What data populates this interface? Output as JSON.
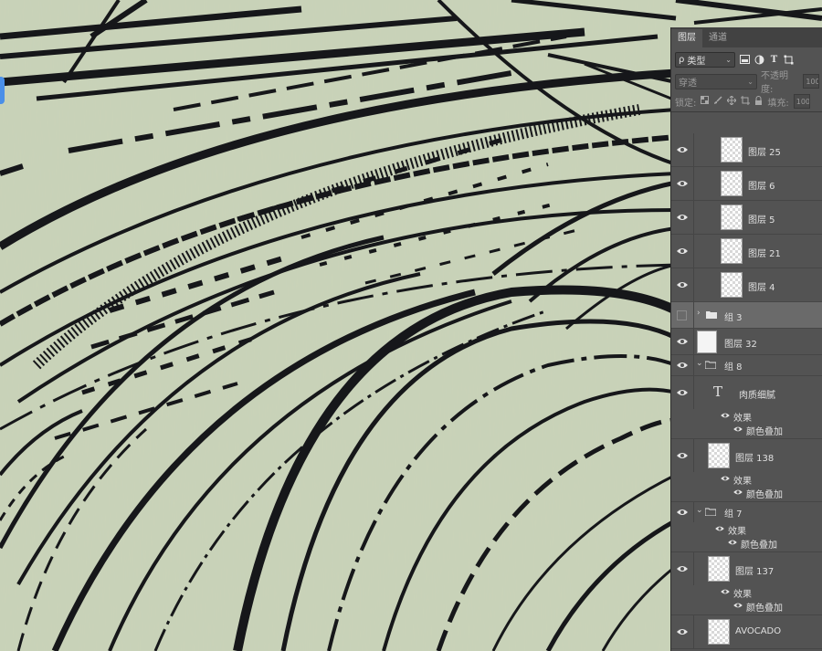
{
  "panel": {
    "tabs": [
      {
        "label": "图层",
        "active": true
      },
      {
        "label": "通道",
        "active": false
      }
    ],
    "filter": {
      "prefix": "ρ",
      "value": "类型"
    },
    "blend": {
      "value": "穿透",
      "opacity_label": "不透明度:",
      "opacity_value": "100"
    },
    "lock": {
      "label": "锁定:",
      "fill_label": "填充:",
      "fill_value": "100"
    },
    "layers": [
      {
        "name": "图层 25",
        "kind": "pixel"
      },
      {
        "name": "图层 6",
        "kind": "pixel"
      },
      {
        "name": "图层 5",
        "kind": "pixel"
      },
      {
        "name": "图层 21",
        "kind": "pixel"
      },
      {
        "name": "图层 4",
        "kind": "pixel"
      },
      {
        "name": "组 3",
        "kind": "group-collapsed"
      },
      {
        "name": "图层 32",
        "kind": "pixel-white"
      },
      {
        "name": "组 8",
        "kind": "group-open"
      },
      {
        "name": "肉质细腻",
        "kind": "text"
      },
      {
        "effects_label": "效果",
        "effect": "颜色叠加"
      },
      {
        "name": "图层 138",
        "kind": "pixel"
      },
      {
        "effects_label": "效果",
        "effect": "颜色叠加"
      },
      {
        "name": "组 7",
        "kind": "group-open"
      },
      {
        "effects_label": "效果",
        "effect": "颜色叠加"
      },
      {
        "name": "图层 137",
        "kind": "pixel"
      },
      {
        "effects_label": "效果",
        "effect": "颜色叠加"
      },
      {
        "name": "AVOCADO",
        "kind": "pixel"
      }
    ]
  },
  "colors": {
    "canvas_bg": "#c9d3b8",
    "ink": "#16171a",
    "panel_bg": "#535353",
    "selection_accent": "#4a8fe8"
  }
}
